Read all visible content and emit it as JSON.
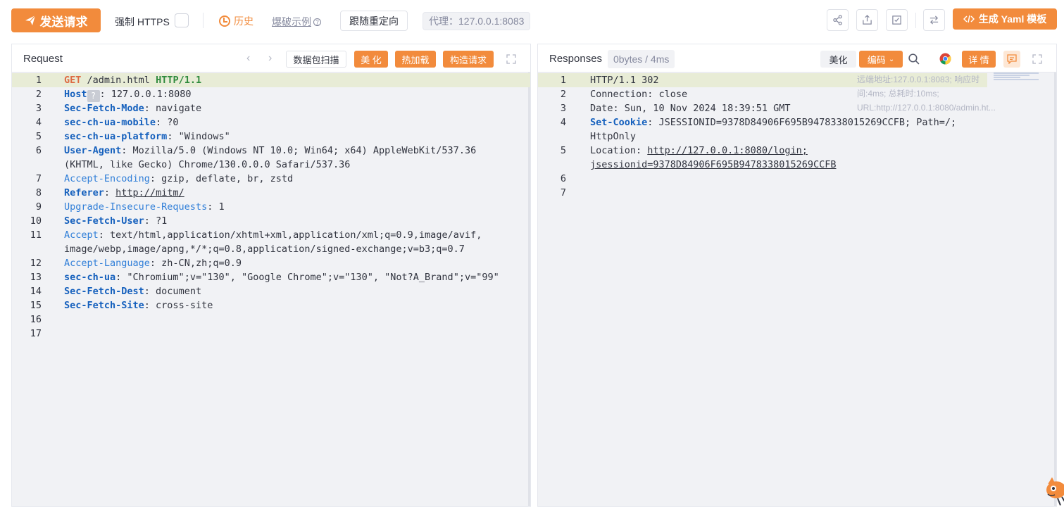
{
  "toolbar": {
    "send_label": "发送请求",
    "https_label": "强制 HTTPS",
    "history_label": "历史",
    "example_label": "爆破示例",
    "redirect_label": "跟随重定向",
    "proxy_label": "代理：127.0.0.1:8083",
    "yaml_label": "生成 Yaml 模板",
    "accent_color": "#f28b3c",
    "icons": [
      "share-icon",
      "export-icon",
      "checkbox-icon",
      "swap-icon"
    ]
  },
  "request": {
    "title": "Request",
    "scan_label": "数据包扫描",
    "beautify_label": "美 化",
    "hotload_label": "热加载",
    "construct_label": "构造请求",
    "lines": [
      {
        "n": "1",
        "method": "GET",
        "path": " /admin.html ",
        "proto": "HTTP/1.1"
      },
      {
        "n": "2",
        "key": "Host",
        "val": ": 127.0.0.1:8080"
      },
      {
        "n": "3",
        "key": "Sec-Fetch-Mode",
        "val": ": navigate"
      },
      {
        "n": "4",
        "key": "sec-ch-ua-mobile",
        "val": ": ?0"
      },
      {
        "n": "5",
        "key": "sec-ch-ua-platform",
        "val": ": \"Windows\""
      },
      {
        "n": "6",
        "key": "User-Agent",
        "val": ": Mozilla/5.0 (Windows NT 10.0; Win64; x64) AppleWebKit/537.36",
        "cont": "(KHTML, like Gecko) Chrome/130.0.0.0 Safari/537.36"
      },
      {
        "n": "7",
        "key": "Accept-Encoding",
        "val": ": gzip, deflate, br, zstd"
      },
      {
        "n": "8",
        "key": "Referer",
        "val": ": ",
        "link": "http://mitm/"
      },
      {
        "n": "9",
        "key": "Upgrade-Insecure-Requests",
        "val": ": 1"
      },
      {
        "n": "10",
        "key": "Sec-Fetch-User",
        "val": ": ?1"
      },
      {
        "n": "11",
        "key": "Accept",
        "val": ": text/html,application/xhtml+xml,application/xml;q=0.9,image/avif,",
        "cont": "image/webp,image/apng,*/*;q=0.8,application/signed-exchange;v=b3;q=0.7"
      },
      {
        "n": "12",
        "key": "Accept-Language",
        "val": ": zh-CN,zh;q=0.9"
      },
      {
        "n": "13",
        "key": "sec-ch-ua",
        "val": ": \"Chromium\";v=\"130\", \"Google Chrome\";v=\"130\", \"Not?A_Brand\";v=\"99\""
      },
      {
        "n": "14",
        "key": "Sec-Fetch-Dest",
        "val": ": document"
      },
      {
        "n": "15",
        "key": "Sec-Fetch-Site",
        "val": ": cross-site"
      },
      {
        "n": "16"
      },
      {
        "n": "17"
      }
    ]
  },
  "response": {
    "title": "Responses",
    "size_label": "0bytes / 4ms",
    "beautify_label": "美化",
    "encoding_label": "编码",
    "detail_label": "详 情",
    "meta_text": "远端地址:127.0.0.1:8083; 响应时间:4ms; 总耗时:10ms; URL:http://127.0.0.1:8080/admin.ht...",
    "lines": [
      {
        "n": "1",
        "text": "HTTP/1.1 302"
      },
      {
        "n": "2",
        "text": "Connection: close"
      },
      {
        "n": "3",
        "text": "Date: Sun, 10 Nov 2024 18:39:51 GMT"
      },
      {
        "n": "4",
        "key": "Set-Cookie",
        "val": ": JSESSIONID=9378D84906F695B9478338015269CCFB; Path=/;",
        "cont": "HttpOnly"
      },
      {
        "n": "5",
        "text": "Location: ",
        "link": "http://127.0.0.1:8080/login;",
        "cont_link": "jsessionid=9378D84906F695B9478338015269CCFB"
      },
      {
        "n": "6"
      },
      {
        "n": "7"
      }
    ]
  }
}
